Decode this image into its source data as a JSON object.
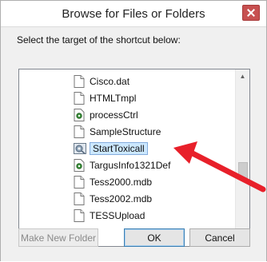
{
  "window": {
    "title": "Browse for Files or Folders",
    "close_glyph": "close-icon"
  },
  "instruction": "Select the target of the shortcut below:",
  "tree": {
    "items": [
      {
        "label": "Cisco.dat",
        "icon": "document-icon",
        "selected": false
      },
      {
        "label": "HTMLTmpl",
        "icon": "document-icon",
        "selected": false
      },
      {
        "label": "processCtrl",
        "icon": "settings-file-icon",
        "selected": false
      },
      {
        "label": "SampleStructure",
        "icon": "document-icon",
        "selected": false
      },
      {
        "label": "StartToxicall",
        "icon": "executable-icon",
        "selected": true
      },
      {
        "label": "TargusInfo1321Def",
        "icon": "settings-file-icon",
        "selected": false
      },
      {
        "label": "Tess2000.mdb",
        "icon": "document-icon",
        "selected": false
      },
      {
        "label": "Tess2002.mdb",
        "icon": "document-icon",
        "selected": false
      },
      {
        "label": "TESSUpload",
        "icon": "document-icon",
        "selected": false
      }
    ]
  },
  "buttons": {
    "make_new_folder": "Make New Folder",
    "ok": "OK",
    "cancel": "Cancel"
  },
  "annotation": {
    "arrow_color": "#e8202a",
    "points_to": "StartToxicall"
  }
}
